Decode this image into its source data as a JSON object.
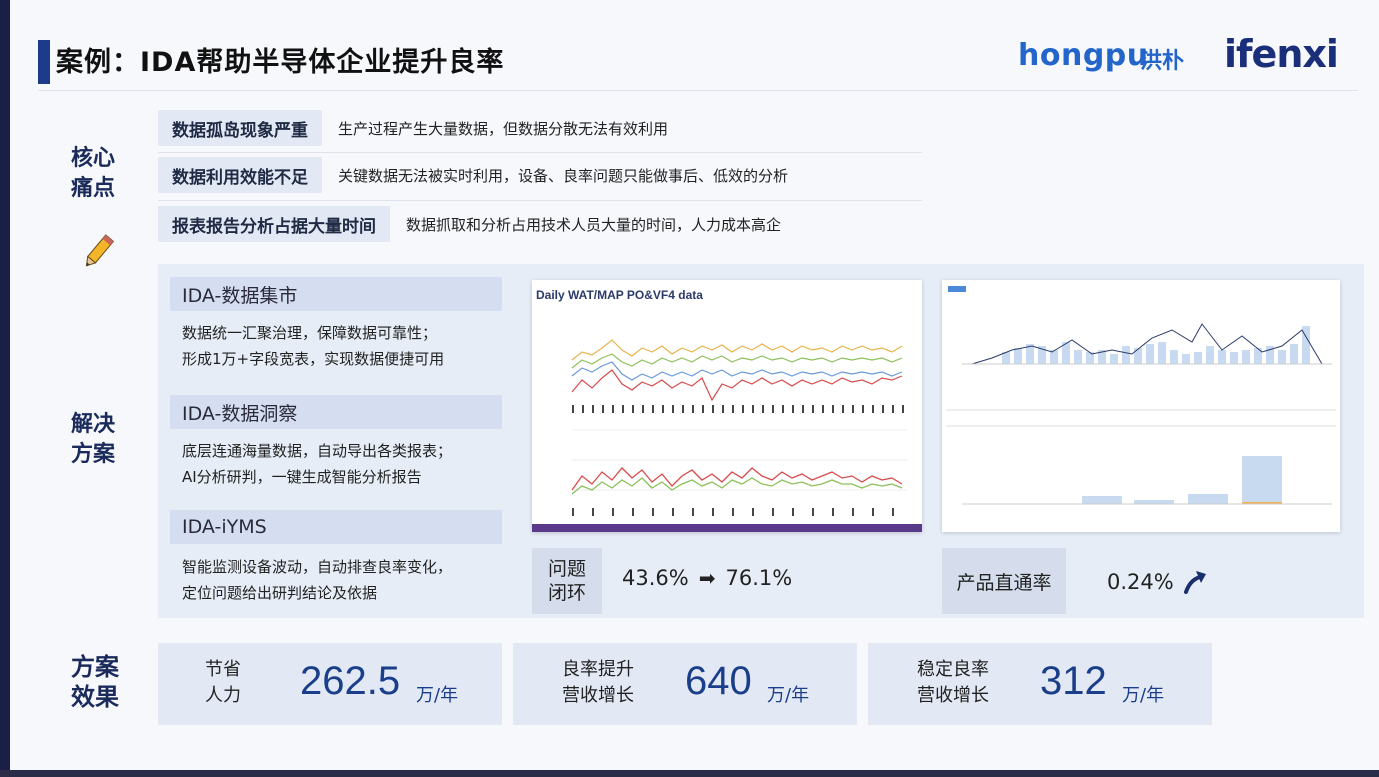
{
  "title": "案例：IDA帮助半导体企业提升良率",
  "logos": {
    "hongpu": "hongpu",
    "hongpu_cn": "洪朴",
    "ifenxi": "ifenxi"
  },
  "pain": {
    "label": "核心痛点",
    "label_l1": "核心",
    "label_l2": "痛点",
    "items": [
      {
        "tag": "数据孤岛现象严重",
        "desc": "生产过程产生大量数据，但数据分散无法有效利用"
      },
      {
        "tag": "数据利用效能不足",
        "desc": "关键数据无法被实时利用，设备、良率问题只能做事后、低效的分析"
      },
      {
        "tag": "报表报告分析占据大量时间",
        "desc": "数据抓取和分析占用技术人员大量的时间，人力成本高企"
      }
    ]
  },
  "solution": {
    "label_l1": "解决",
    "label_l2": "方案",
    "modules": [
      {
        "title": "IDA-数据集市",
        "line1": "数据统一汇聚治理，保障数据可靠性；",
        "line2": "形成1万+字段宽表，实现数据便捷可用"
      },
      {
        "title": "IDA-数据洞察",
        "line1": "底层连通海量数据，自动导出各类报表；",
        "line2": "AI分析研判，一键生成智能分析报告"
      },
      {
        "title": "IDA-iYMS",
        "line1": "智能监测设备波动，自动排查良率变化，",
        "line2": "定位问题给出研判结论及依据"
      }
    ],
    "panel1": {
      "title": "Daily WAT/MAP PO&VF4 data"
    },
    "metric1": {
      "label_l1": "问题",
      "label_l2": "闭环",
      "from": "43.6%",
      "arrow": "➡",
      "to": "76.1%"
    },
    "metric2": {
      "label": "产品直通率",
      "value": "0.24%",
      "icon": "trend-up-arrow"
    }
  },
  "results": {
    "label_l1": "方案",
    "label_l2": "效果",
    "cards": [
      {
        "label_l1": "节省",
        "label_l2": "人力",
        "value": "262.5",
        "unit": "万/年"
      },
      {
        "label_l1": "良率提升",
        "label_l2": "营收增长",
        "value": "640",
        "unit": "万/年"
      },
      {
        "label_l1": "稳定良率",
        "label_l2": "营收增长",
        "value": "312",
        "unit": "万/年"
      }
    ]
  },
  "colors": {
    "accent": "#1c3b8a",
    "value": "#1a3e8a",
    "tag_bg": "#e3e9f4"
  }
}
